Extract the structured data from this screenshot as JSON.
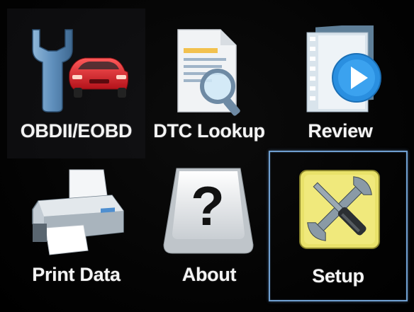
{
  "menu": {
    "items": [
      {
        "id": "obd",
        "label": "OBDII/EOBD",
        "icon": "wrench-car-icon"
      },
      {
        "id": "dtc",
        "label": "DTC Lookup",
        "icon": "document-magnifier-icon"
      },
      {
        "id": "review",
        "label": "Review",
        "icon": "film-play-icon"
      },
      {
        "id": "print",
        "label": "Print Data",
        "icon": "printer-icon"
      },
      {
        "id": "about",
        "label": "About",
        "icon": "question-key-icon"
      },
      {
        "id": "setup",
        "label": "Setup",
        "icon": "tools-icon"
      }
    ],
    "selected": "setup"
  },
  "colors": {
    "background": "#060606",
    "label": "#f4f4f4",
    "selection_border": "#6f9fd0",
    "car_red": "#d8232a",
    "play_blue": "#2a8fe0",
    "setup_yellow": "#e9e26a"
  }
}
